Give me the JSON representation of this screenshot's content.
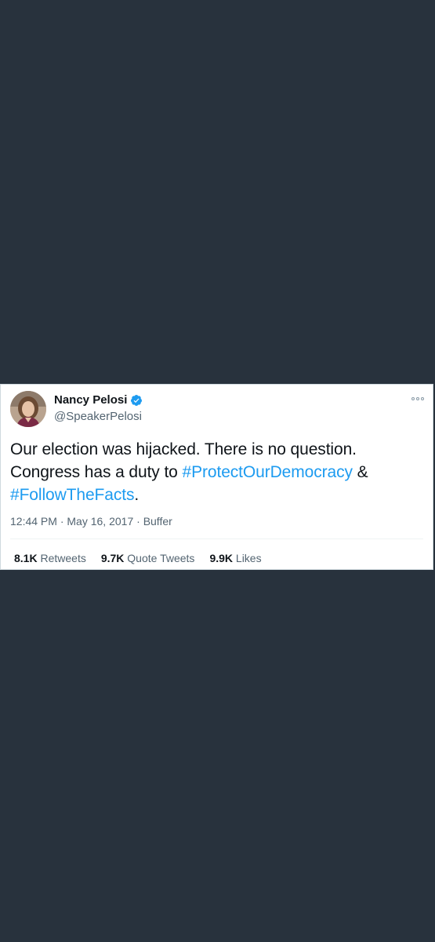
{
  "tweet": {
    "display_name": "Nancy Pelosi",
    "handle": "@SpeakerPelosi",
    "verified": true,
    "text_parts": {
      "line1": "Our election was hijacked. There is no question.",
      "line2_prefix": "Congress has a duty to ",
      "hashtag1": "#ProtectOurDemocracy",
      "line2_suffix": " &",
      "hashtag2": "#FollowTheFacts",
      "line3_suffix": "."
    },
    "time": "12:44 PM",
    "date": "May 16, 2017",
    "source": "Buffer",
    "separator": " · ",
    "stats": {
      "retweets_count": "8.1K",
      "retweets_label": "Retweets",
      "quotes_count": "9.7K",
      "quotes_label": "Quote Tweets",
      "likes_count": "9.9K",
      "likes_label": "Likes"
    }
  },
  "colors": {
    "background": "#28323d",
    "card": "#ffffff",
    "hashtag": "#1d9bf0",
    "verified": "#1d9bf0"
  },
  "icons": {
    "verified": "verified-badge-icon",
    "more": "more-options-icon"
  }
}
